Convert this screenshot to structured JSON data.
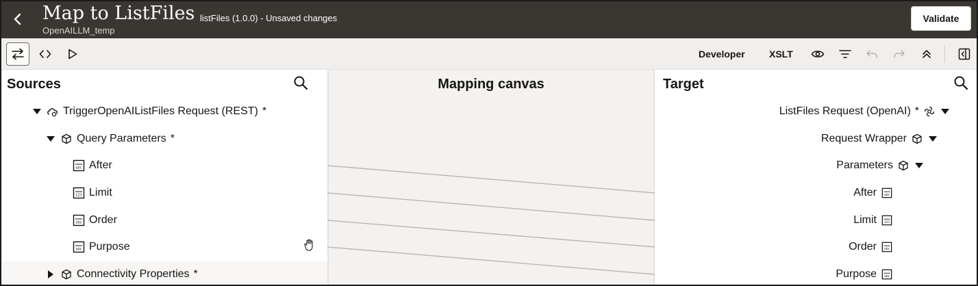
{
  "header": {
    "title": "Map to ListFiles",
    "subtitle": "OpenAILLM_temp",
    "status": "listFiles (1.0.0) - Unsaved changes",
    "validate_label": "Validate"
  },
  "toolbar": {
    "developer_label": "Developer",
    "xslt_label": "XSLT"
  },
  "sources": {
    "title": "Sources",
    "root": "TriggerOpenAIListFiles Request (REST)",
    "root_required": "*",
    "query_params": "Query Parameters",
    "query_params_required": "*",
    "fields": [
      "After",
      "Limit",
      "Order",
      "Purpose"
    ],
    "connectivity": "Connectivity Properties",
    "connectivity_required": "*"
  },
  "canvas": {
    "title": "Mapping canvas"
  },
  "target": {
    "title": "Target",
    "root": "ListFiles Request (OpenAI)",
    "root_required": "*",
    "wrapper": "Request Wrapper",
    "parameters": "Parameters",
    "fields": [
      "After",
      "Limit",
      "Order",
      "Purpose"
    ]
  },
  "colors": {
    "header_bg": "#3a3632",
    "toolbar_bg": "#f1efed",
    "canvas_bg": "#f3f2f0",
    "mapping_line": "#b9b6b1"
  }
}
